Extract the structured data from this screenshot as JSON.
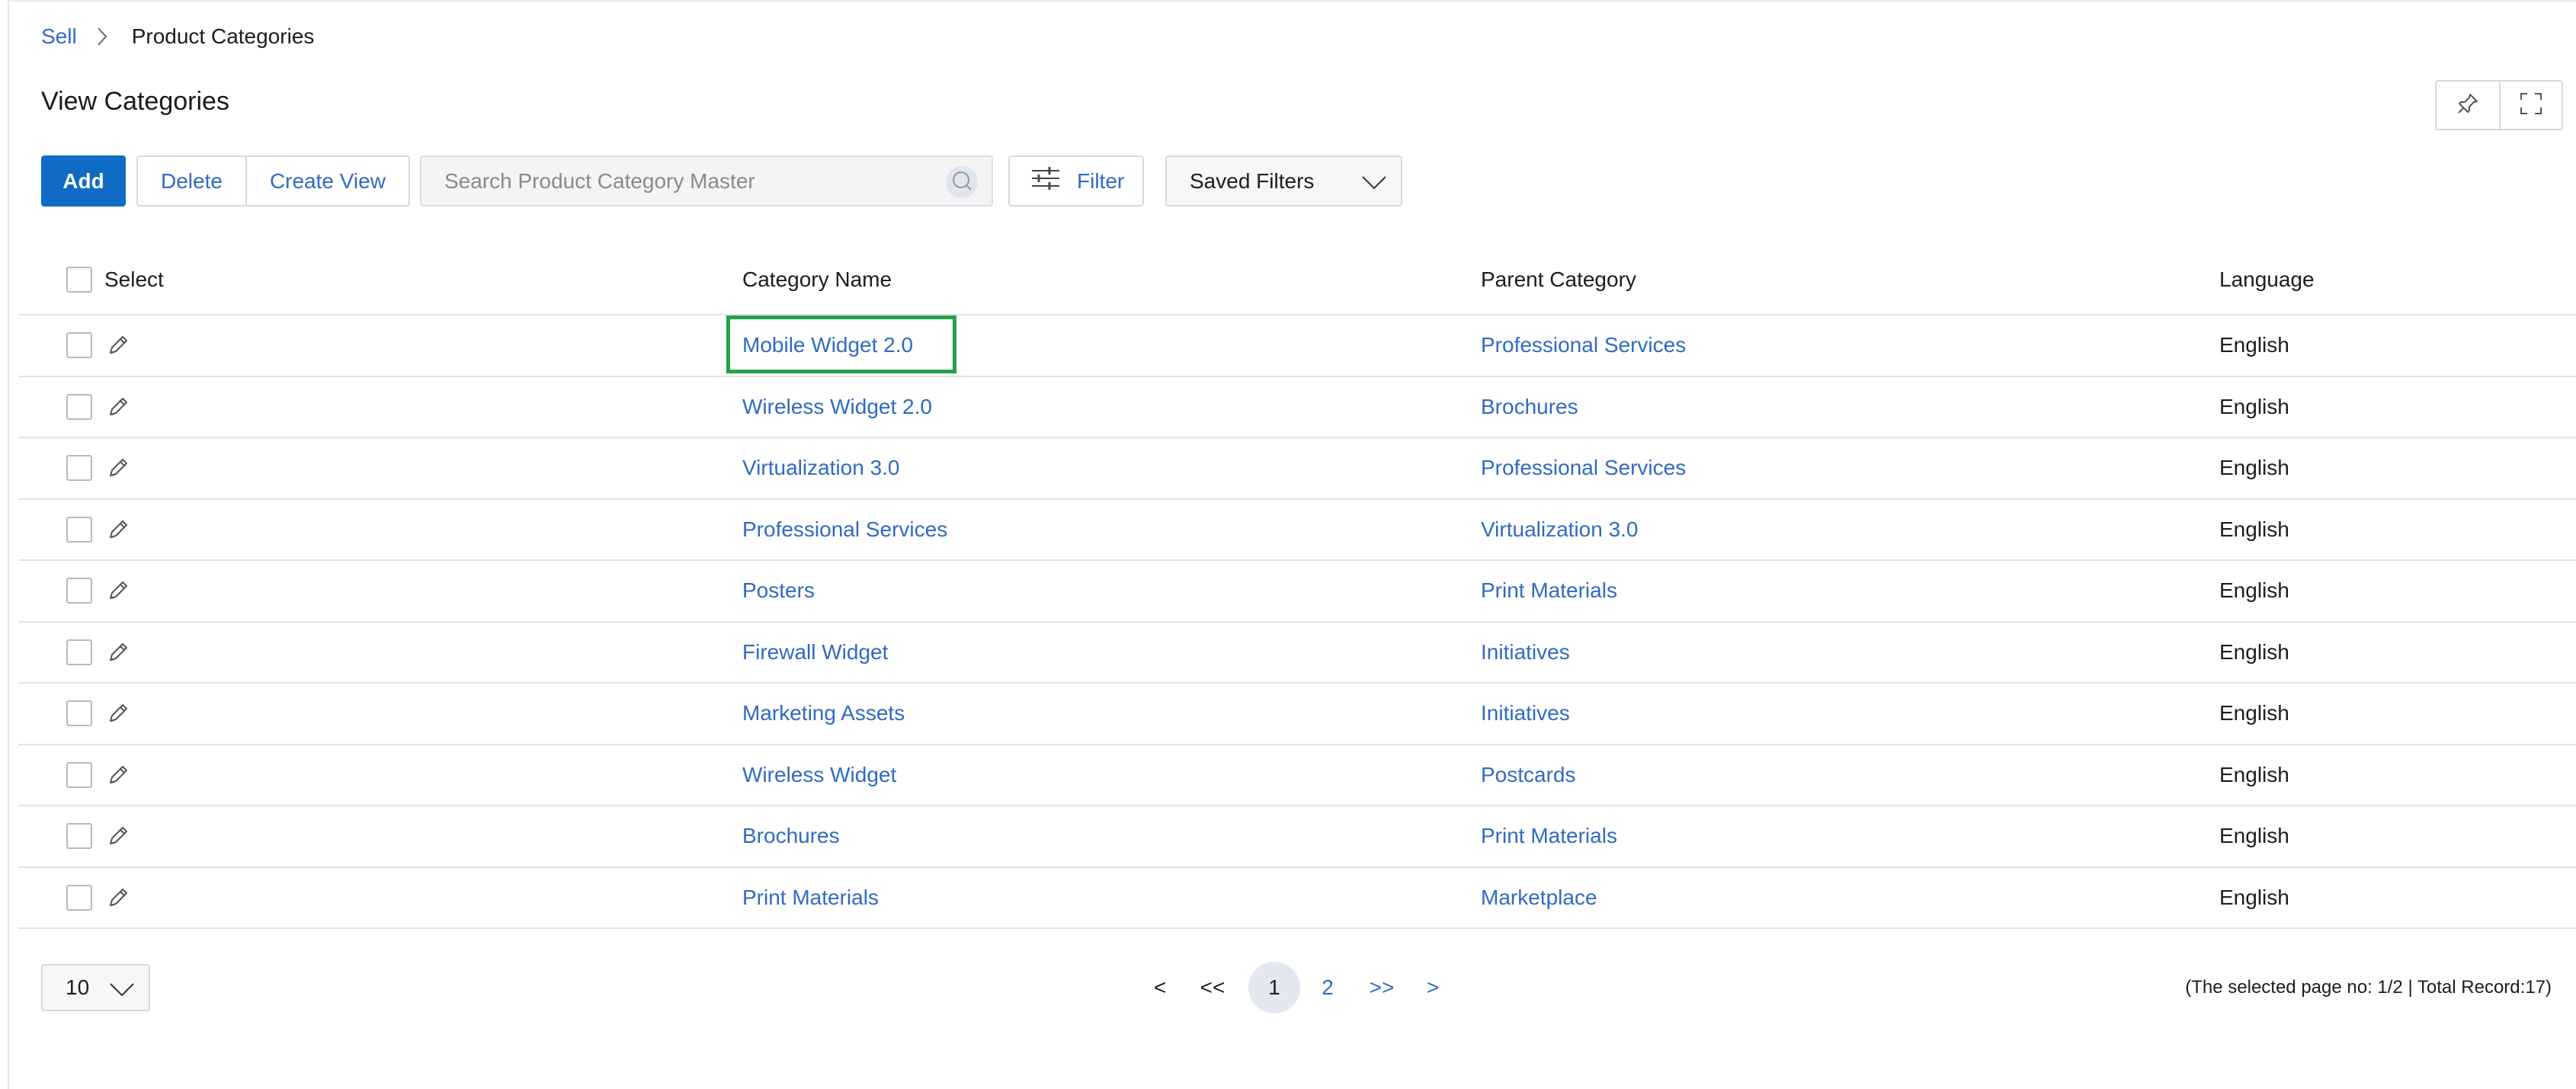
{
  "breadcrumb": {
    "root": "Sell",
    "current": "Product Categories"
  },
  "page": {
    "title": "View Categories"
  },
  "toolbar": {
    "add_label": "Add",
    "delete_label": "Delete",
    "create_view_label": "Create View",
    "search_placeholder": "Search Product Category Master",
    "search_value": "",
    "filter_label": "Filter",
    "saved_filters_label": "Saved Filters"
  },
  "top_right_icons": [
    "pin-icon",
    "fullscreen-icon"
  ],
  "table": {
    "headers": {
      "select": "Select",
      "category": "Category Name",
      "parent": "Parent Category",
      "language": "Language"
    },
    "rows": [
      {
        "category": "Mobile Widget 2.0",
        "parent": "Professional Services",
        "language": "English"
      },
      {
        "category": "Wireless Widget 2.0",
        "parent": "Brochures",
        "language": "English"
      },
      {
        "category": "Virtualization 3.0",
        "parent": "Professional Services",
        "language": "English"
      },
      {
        "category": "Professional Services",
        "parent": "Virtualization 3.0",
        "language": "English"
      },
      {
        "category": "Posters",
        "parent": "Print Materials",
        "language": "English"
      },
      {
        "category": "Firewall Widget",
        "parent": "Initiatives",
        "language": "English"
      },
      {
        "category": "Marketing Assets",
        "parent": "Initiatives",
        "language": "English"
      },
      {
        "category": "Wireless Widget",
        "parent": "Postcards",
        "language": "English"
      },
      {
        "category": "Brochures",
        "parent": "Print Materials",
        "language": "English"
      },
      {
        "category": "Print Materials",
        "parent": "Marketplace",
        "language": "English"
      }
    ]
  },
  "pagination": {
    "page_size": "10",
    "prev": "<",
    "first": "<<",
    "current": "1",
    "page2": "2",
    "last": ">>",
    "next": ">",
    "info": "(The selected page no: 1/2 | Total Record:17)"
  },
  "colors": {
    "accent": "#0f6bc4",
    "link": "#2f6bc1",
    "highlight": "#23a148"
  }
}
